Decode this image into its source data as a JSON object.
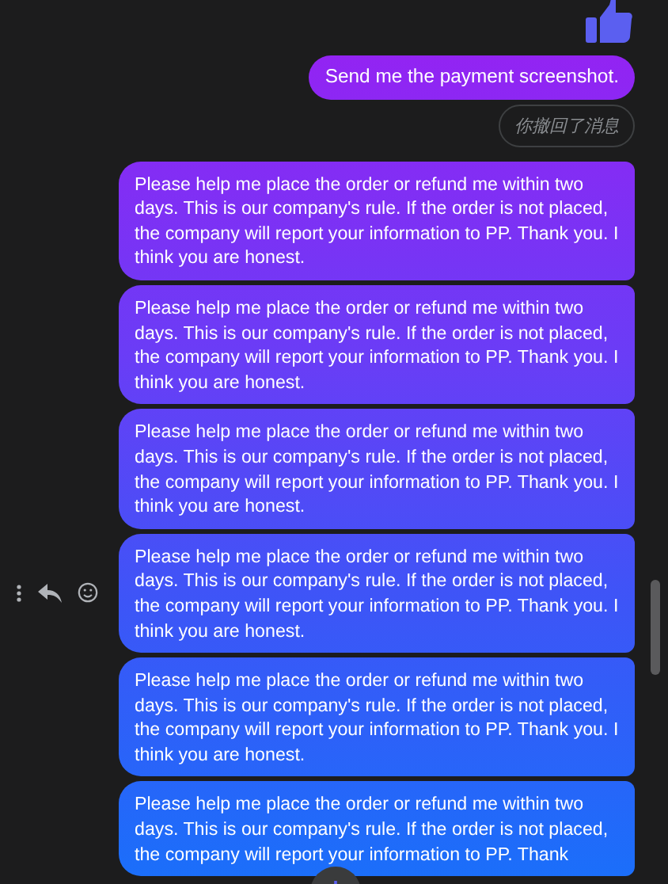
{
  "messages": [
    {
      "kind": "like",
      "show_actions": false
    },
    {
      "kind": "text",
      "text": "Send me the payment screenshot.",
      "show_actions": false
    },
    {
      "kind": "recalled",
      "text": "你撤回了消息",
      "show_actions": false
    },
    {
      "kind": "text",
      "text": "Please help me place the order or refund me within two days. This is our company's rule. If the order is not placed, the company will report your information to PP. Thank you. I think you are honest.",
      "show_actions": false
    },
    {
      "kind": "text",
      "text": "Please help me place the order or refund me within two days. This is our company's rule. If the order is not placed, the company will report your information to PP. Thank you. I think you are honest.",
      "show_actions": false
    },
    {
      "kind": "text",
      "text": "Please help me place the order or refund me within two days. This is our company's rule. If the order is not placed, the company will report your information to PP. Thank you. I think you are honest.",
      "show_actions": false
    },
    {
      "kind": "text",
      "text": "Please help me place the order or refund me within two days. This is our company's rule. If the order is not placed, the company will report your information to PP. Thank you. I think you are honest.",
      "show_actions": true
    },
    {
      "kind": "text",
      "text": "Please help me place the order or refund me within two days. This is our company's rule. If the order is not placed, the company will report your information to PP. Thank you. I think you are honest.",
      "show_actions": false
    },
    {
      "kind": "text",
      "text": "Please help me place the order or refund me within two days. This is our company's rule. If the order is not placed, the company will report your information to PP. Thank",
      "show_actions": false
    }
  ]
}
